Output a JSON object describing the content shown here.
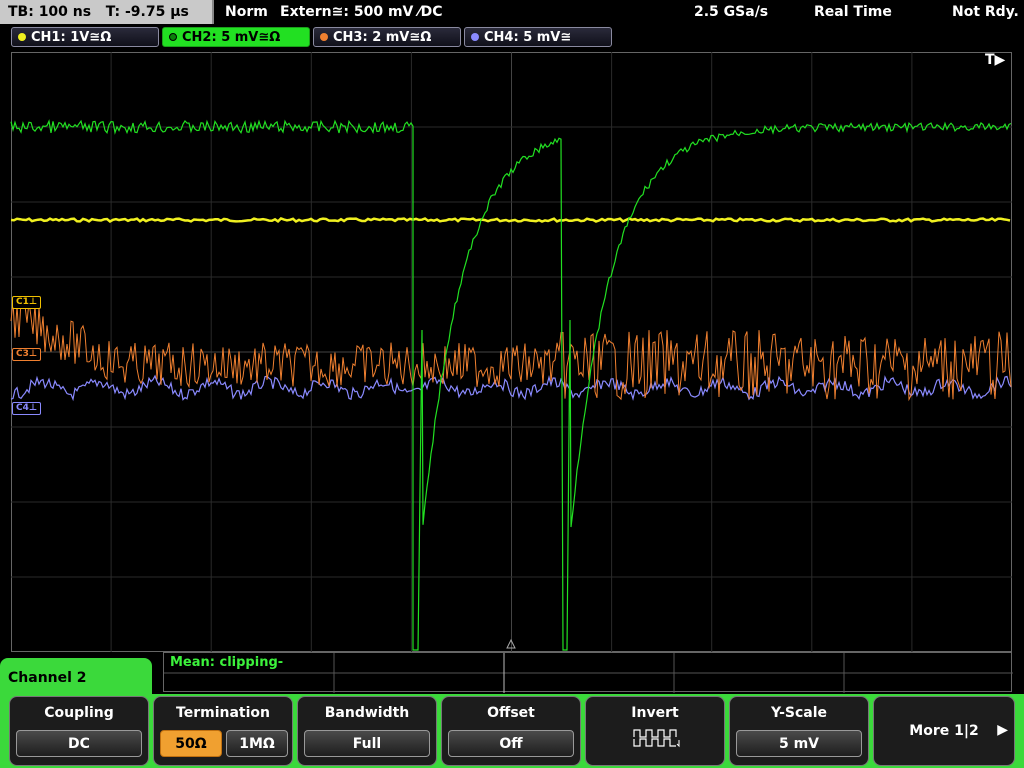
{
  "status": {
    "timebase": "TB: 100 ns",
    "trigger_time": "T: -9.75 µs",
    "trigger_mode": "Norm",
    "trigger_source": "Extern≅: 500 mV ⁄DC",
    "sample_rate": "2.5 GSa/s",
    "acq_mode": "Real Time",
    "state": "Not Rdy."
  },
  "channels": [
    {
      "label": "CH1: 1V≅Ω",
      "color": "#f0f020"
    },
    {
      "label": "CH2: 5 mV≅Ω",
      "color": "#22e022"
    },
    {
      "label": "CH3: 2 mV≅Ω",
      "color": "#f08030"
    },
    {
      "label": "CH4: 5 mV≅",
      "color": "#8a8aff"
    }
  ],
  "markers": {
    "trigger": "T▶",
    "c1": "C1⊥",
    "c3": "C3⊥",
    "c4": "C4⊥"
  },
  "measurement": {
    "text": "Mean: clipping-"
  },
  "menu": {
    "channel_tab": "Channel 2",
    "coupling": {
      "title": "Coupling",
      "value": "DC"
    },
    "termination": {
      "title": "Termination",
      "opt1": "50Ω",
      "opt2": "1MΩ"
    },
    "bandwidth": {
      "title": "Bandwidth",
      "value": "Full"
    },
    "offset": {
      "title": "Offset",
      "value": "Off"
    },
    "invert": {
      "title": "Invert"
    },
    "yscale": {
      "title": "Y-Scale",
      "value": "5 mV"
    },
    "more": {
      "label": "More 1|2"
    }
  }
}
